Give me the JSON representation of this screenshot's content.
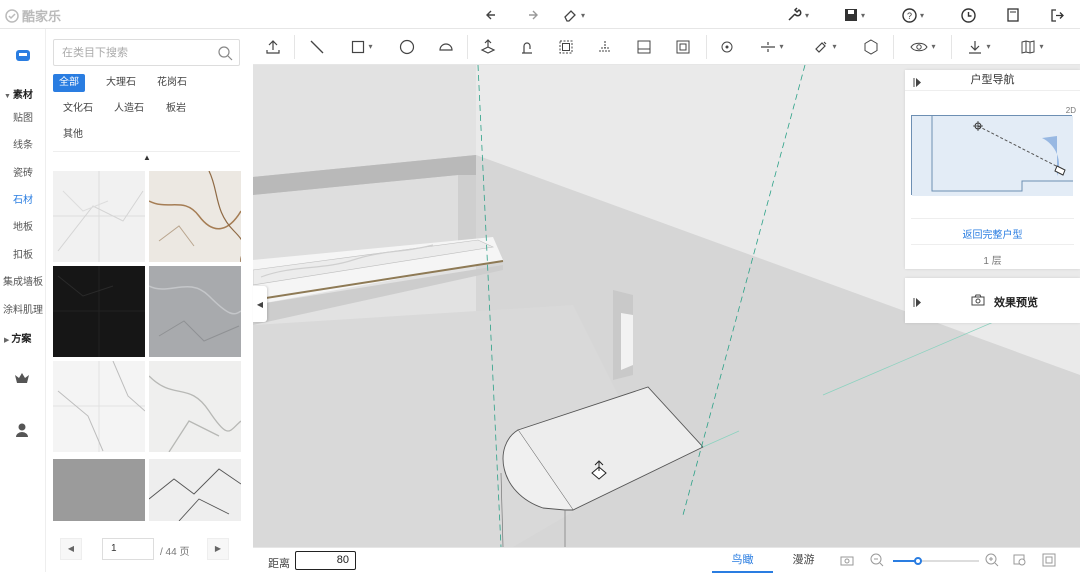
{
  "app": {
    "name": "酷家乐"
  },
  "left_rail": {
    "items": [
      {
        "label": "素材",
        "type": "section"
      },
      {
        "label": "贴图"
      },
      {
        "label": "线条"
      },
      {
        "label": "瓷砖"
      },
      {
        "label": "石材",
        "active": true
      },
      {
        "label": "地板"
      },
      {
        "label": "扣板"
      },
      {
        "label": "集成墙板"
      },
      {
        "label": "涂料肌理"
      },
      {
        "label": "方案",
        "type": "section"
      }
    ]
  },
  "material_panel": {
    "search_placeholder": "在类目下搜索",
    "categories": [
      {
        "label": "全部",
        "active": true
      },
      {
        "label": "大理石"
      },
      {
        "label": "花岗石"
      },
      {
        "label": "文化石"
      },
      {
        "label": "人造石"
      },
      {
        "label": "板岩"
      },
      {
        "label": "其他"
      }
    ],
    "thumbnails": [
      "white-marble-grid",
      "calacatta-gold-marble",
      "black-granite",
      "grey-marble",
      "white-veined-marble",
      "white-grey-veined-marble",
      "grey-concrete-stone",
      "white-black-veined-marble"
    ],
    "pager": {
      "current_page": "1",
      "total": "/ 44 页"
    }
  },
  "toolbar": {
    "icons": [
      "upload-icon",
      "line-tool-icon",
      "rectangle-tool-icon",
      "circle-tool-icon",
      "arc-tool-icon",
      "push-pull-icon",
      "follow-me-icon",
      "offset-icon",
      "tape-icon",
      "section-icon",
      "component-icon",
      "rotate-icon",
      "align-icon",
      "paint-icon",
      "material-icon",
      "view-icon",
      "import-icon",
      "library-icon"
    ]
  },
  "navigation": {
    "title": "户型导航",
    "tag": "2D",
    "return_link": "返回完整户型",
    "floor": "1 层"
  },
  "preview": {
    "label": "效果预览"
  },
  "bottom": {
    "distance_label": "距离",
    "distance_value": "80",
    "modes": [
      {
        "label": "鸟瞰",
        "active": true
      },
      {
        "label": "漫游"
      }
    ]
  },
  "colors": {
    "accent": "#2a7de1"
  }
}
